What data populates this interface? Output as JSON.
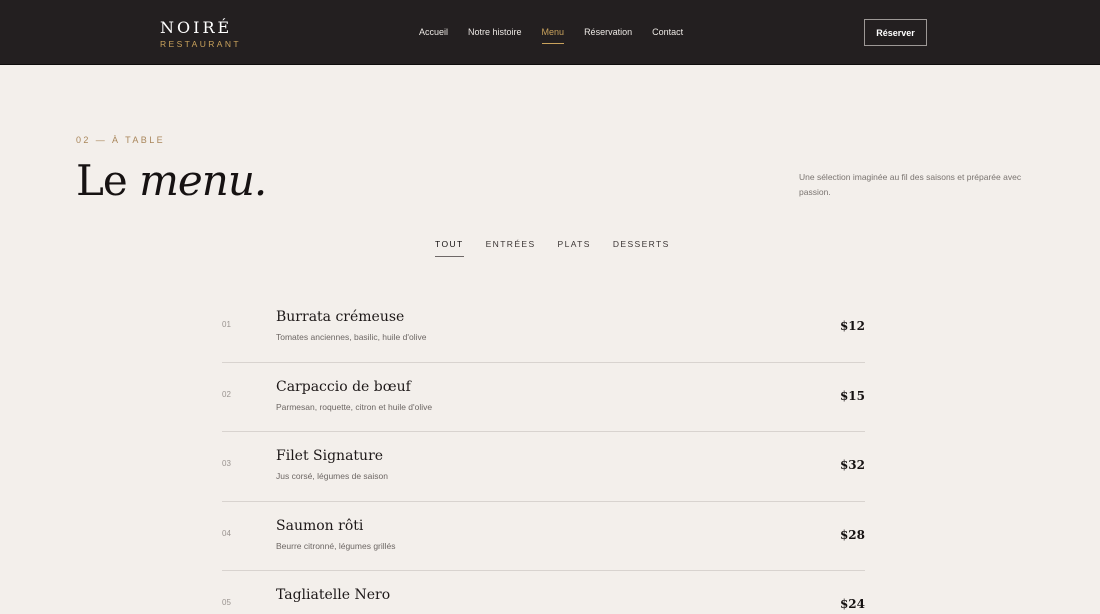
{
  "header": {
    "logo_name": "NOIRÉ",
    "logo_sub": "RESTAURANT",
    "nav": [
      {
        "label": "Accueil"
      },
      {
        "label": "Notre histoire"
      },
      {
        "label": "Menu"
      },
      {
        "label": "Réservation"
      },
      {
        "label": "Contact"
      }
    ],
    "active_nav": "Menu",
    "reserve_label": "Réserver"
  },
  "section": {
    "eyebrow": "02 — À TABLE",
    "heading_plain": "Le ",
    "heading_italic": "menu.",
    "intro": "Une sélection imaginée au fil des saisons et préparée avec passion."
  },
  "filters": [
    {
      "label": "TOUT"
    },
    {
      "label": "ENTRÉES"
    },
    {
      "label": "PLATS"
    },
    {
      "label": "DESSERTS"
    }
  ],
  "active_filter": "TOUT",
  "menu": [
    {
      "num": "01",
      "name": "Burrata crémeuse",
      "desc": "Tomates anciennes, basilic, huile d'olive",
      "price": "$12"
    },
    {
      "num": "02",
      "name": "Carpaccio de bœuf",
      "desc": "Parmesan, roquette, citron et huile d'olive",
      "price": "$15"
    },
    {
      "num": "03",
      "name": "Filet Signature",
      "desc": "Jus corsé, légumes de saison",
      "price": "$32"
    },
    {
      "num": "04",
      "name": "Saumon rôti",
      "desc": "Beurre citronné, légumes grillés",
      "price": "$28"
    },
    {
      "num": "05",
      "name": "Tagliatelle Nero",
      "desc": "",
      "price": "$24"
    }
  ],
  "colors": {
    "header_bg": "#231f20",
    "page_bg": "#f3efeb",
    "accent_gold": "#c9a25c"
  }
}
